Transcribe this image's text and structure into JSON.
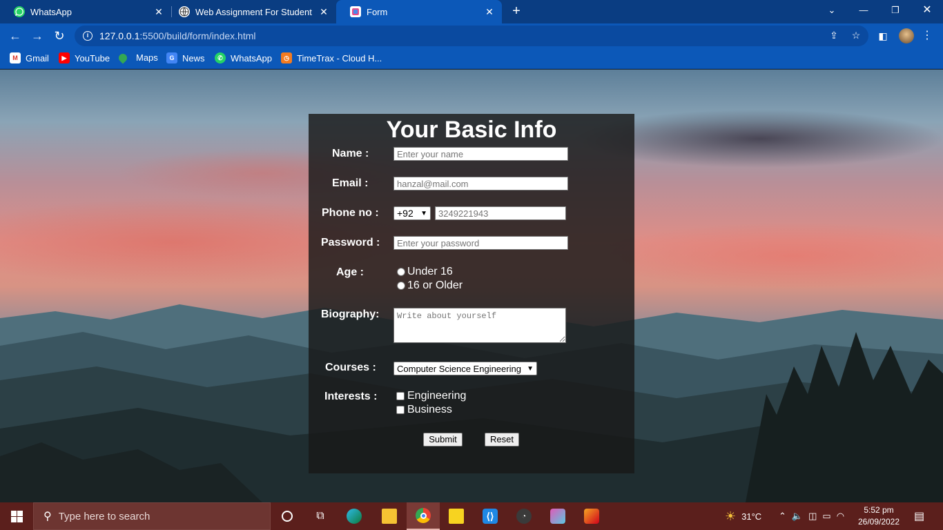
{
  "tabs": [
    {
      "title": "WhatsApp",
      "icon": "whatsapp-icon"
    },
    {
      "title": "Web Assignment For Student",
      "icon": "globe-icon"
    },
    {
      "title": "Form",
      "icon": "form-favicon-icon"
    }
  ],
  "address_bar": {
    "host": "127.0.0.1",
    "path": ":5500/build/form/index.html"
  },
  "bookmarks": [
    {
      "label": "Gmail",
      "icon": "gmail-icon"
    },
    {
      "label": "YouTube",
      "icon": "youtube-icon"
    },
    {
      "label": "Maps",
      "icon": "maps-icon"
    },
    {
      "label": "News",
      "icon": "news-icon"
    },
    {
      "label": "WhatsApp",
      "icon": "whatsapp-icon"
    },
    {
      "label": "TimeTrax - Cloud H...",
      "icon": "timetrax-icon"
    }
  ],
  "form": {
    "title": "Your Basic Info",
    "name_label": "Name :",
    "name_placeholder": "Enter your name",
    "email_label": "Email :",
    "email_placeholder": "hanzal@mail.com",
    "phone_label": "Phone no :",
    "country_code": "+92",
    "phone_placeholder": "3249221943",
    "password_label": "Password :",
    "password_placeholder": "Enter your password",
    "age_label": "Age :",
    "age_options": [
      "Under 16",
      "16 or Older"
    ],
    "bio_label": "Biography:",
    "bio_placeholder": "Write about yourself",
    "courses_label": "Courses :",
    "course_selected": "Computer Science Engineering",
    "interests_label": "Interests :",
    "interests": [
      "Engineering",
      "Business"
    ],
    "submit_label": "Submit",
    "reset_label": "Reset"
  },
  "taskbar": {
    "search_placeholder": "Type here to search",
    "weather": "31°C",
    "time": "5:52 pm",
    "date": "26/09/2022"
  },
  "colors": {
    "tab_strip": "#0a3d82",
    "toolbar": "#0c58b8",
    "taskbar": "#5b1f1c",
    "form_panel": "rgba(25,25,25,0.82)"
  }
}
